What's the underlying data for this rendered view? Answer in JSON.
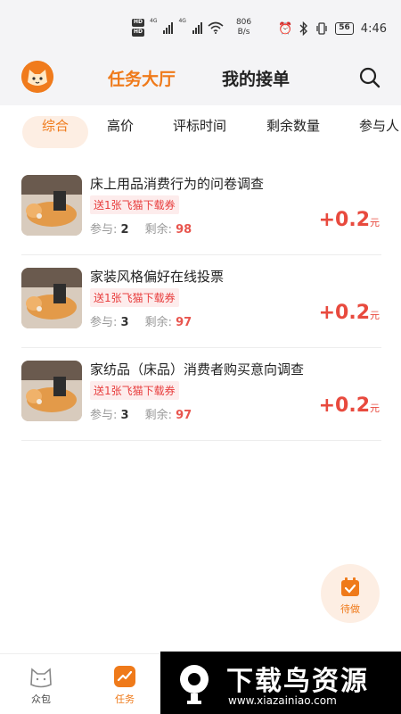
{
  "status_bar": {
    "hd1": "HD",
    "hd2": "HD",
    "signal1_label": "4G",
    "signal2_label": "4G",
    "net_speed_value": "806",
    "net_speed_unit": "B/s",
    "battery": "56",
    "time": "4:46"
  },
  "header": {
    "tab_active": "任务大厅",
    "tab_inactive": "我的接单"
  },
  "filters": [
    "综合",
    "高价",
    "评标时间",
    "剩余数量",
    "参与人"
  ],
  "tasks": [
    {
      "title": "床上用品消费行为的问卷调查",
      "tag": "送1张飞猫下载券",
      "joined_label": "参与:",
      "joined": "2",
      "remain_label": "剩余:",
      "remain": "98",
      "reward": "+0.2",
      "unit": "元"
    },
    {
      "title": "家装风格偏好在线投票",
      "tag": "送1张飞猫下载券",
      "joined_label": "参与:",
      "joined": "3",
      "remain_label": "剩余:",
      "remain": "97",
      "reward": "+0.2",
      "unit": "元"
    },
    {
      "title": "家纺品（床品）消费者购买意向调查",
      "tag": "送1张飞猫下载券",
      "joined_label": "参与:",
      "joined": "3",
      "remain_label": "剩余:",
      "remain": "97",
      "reward": "+0.2",
      "unit": "元"
    }
  ],
  "fab": {
    "label": "待做"
  },
  "bottom_nav": [
    {
      "label": "众包",
      "icon": "cat-icon"
    },
    {
      "label": "任务",
      "icon": "task-chart-icon"
    }
  ],
  "watermark": {
    "title": "下载鸟资源",
    "url": "www.xiazainiao.com"
  },
  "colors": {
    "accent": "#ef7a1a",
    "reward": "#e84a3e",
    "tag_bg": "#fdecec",
    "header_bg": "#f4f4f6"
  }
}
